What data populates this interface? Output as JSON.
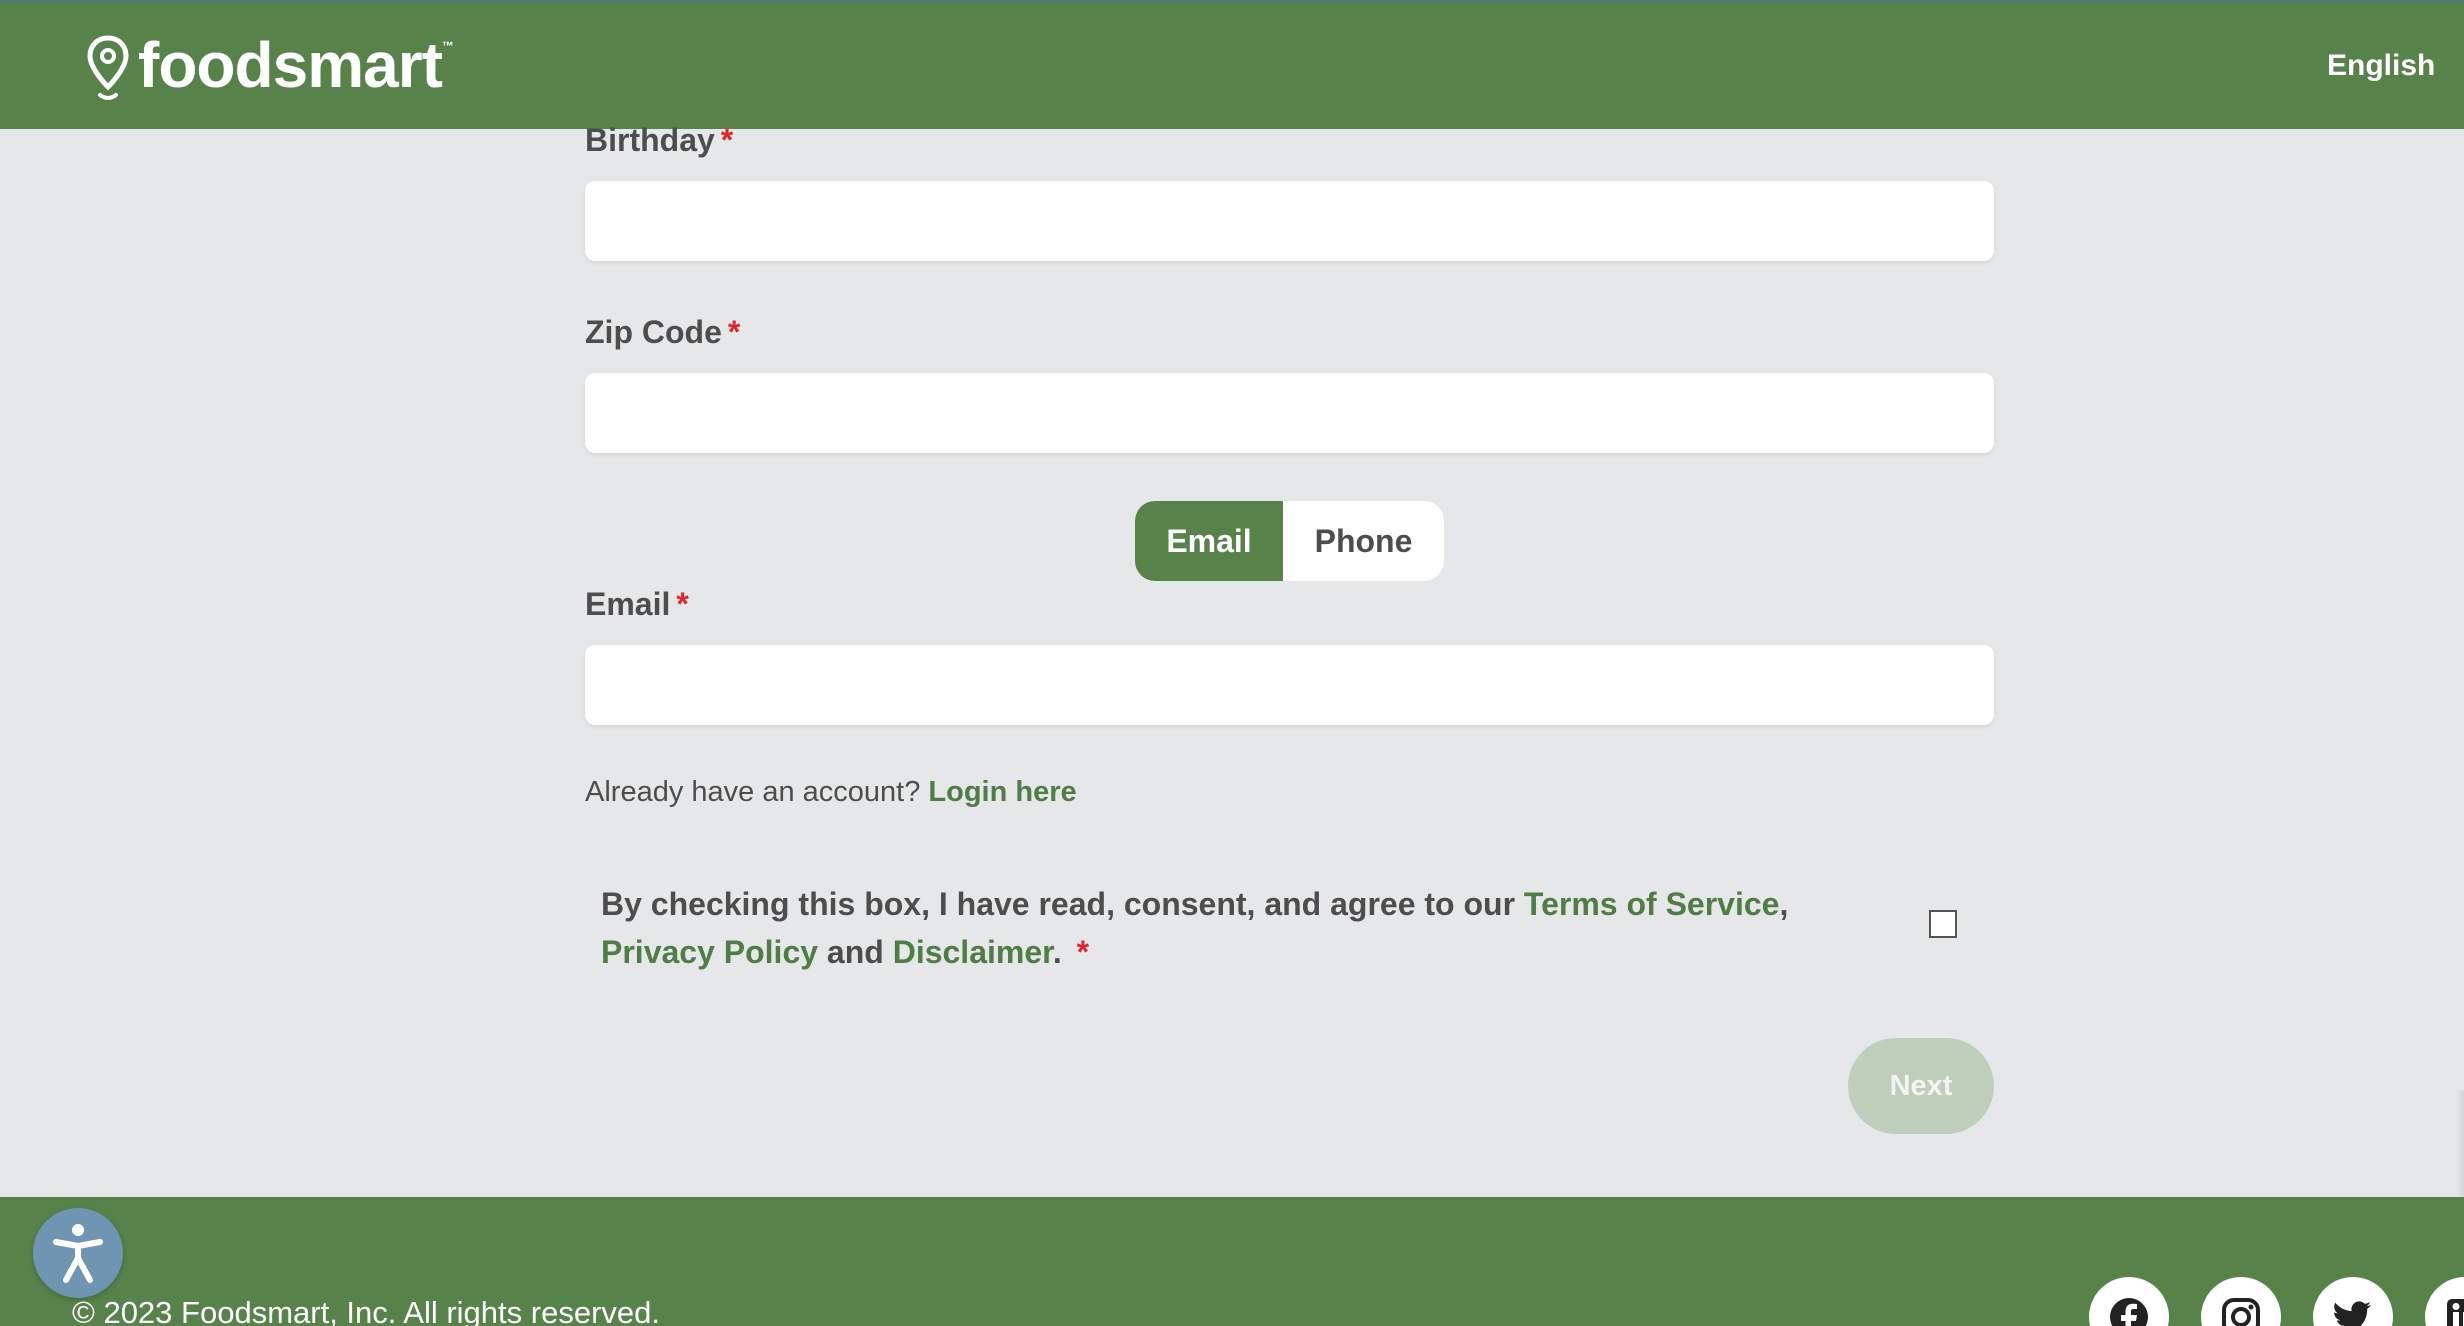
{
  "header": {
    "logo_text": "foodsmart",
    "logo_tm": "™",
    "language": "English"
  },
  "form": {
    "birthday": {
      "label": "Birthday",
      "required": "*",
      "value": ""
    },
    "zip": {
      "label": "Zip Code",
      "required": "*",
      "value": ""
    },
    "contact_toggle": {
      "email": "Email",
      "phone": "Phone",
      "selected": "Email"
    },
    "email": {
      "label": "Email",
      "required": "*",
      "value": ""
    },
    "already_text": "Already have an account?",
    "login_link": "Login here",
    "consent": {
      "prefix": "By checking this box, I have read, consent, and agree to our",
      "terms": "Terms of Service",
      "comma": ",",
      "privacy": "Privacy Policy",
      "and": "and",
      "disclaimer": "Disclaimer",
      "period": ".",
      "required": "*",
      "checked": false
    },
    "next_label": "Next"
  },
  "footer": {
    "copyright": "© 2023 Foodsmart, Inc. All rights reserved."
  },
  "colors": {
    "brand_green": "#57834b",
    "link_green": "#4f7d45",
    "required_red": "#e0262b",
    "background": "#e6e7e9",
    "disabled_button": "#bfcfbb",
    "accessibility_blue": "#6f95b3"
  },
  "icons": [
    "map-pin-icon",
    "globe-icon",
    "accessibility-icon",
    "facebook-icon",
    "instagram-icon",
    "twitter-icon",
    "linkedin-icon"
  ]
}
